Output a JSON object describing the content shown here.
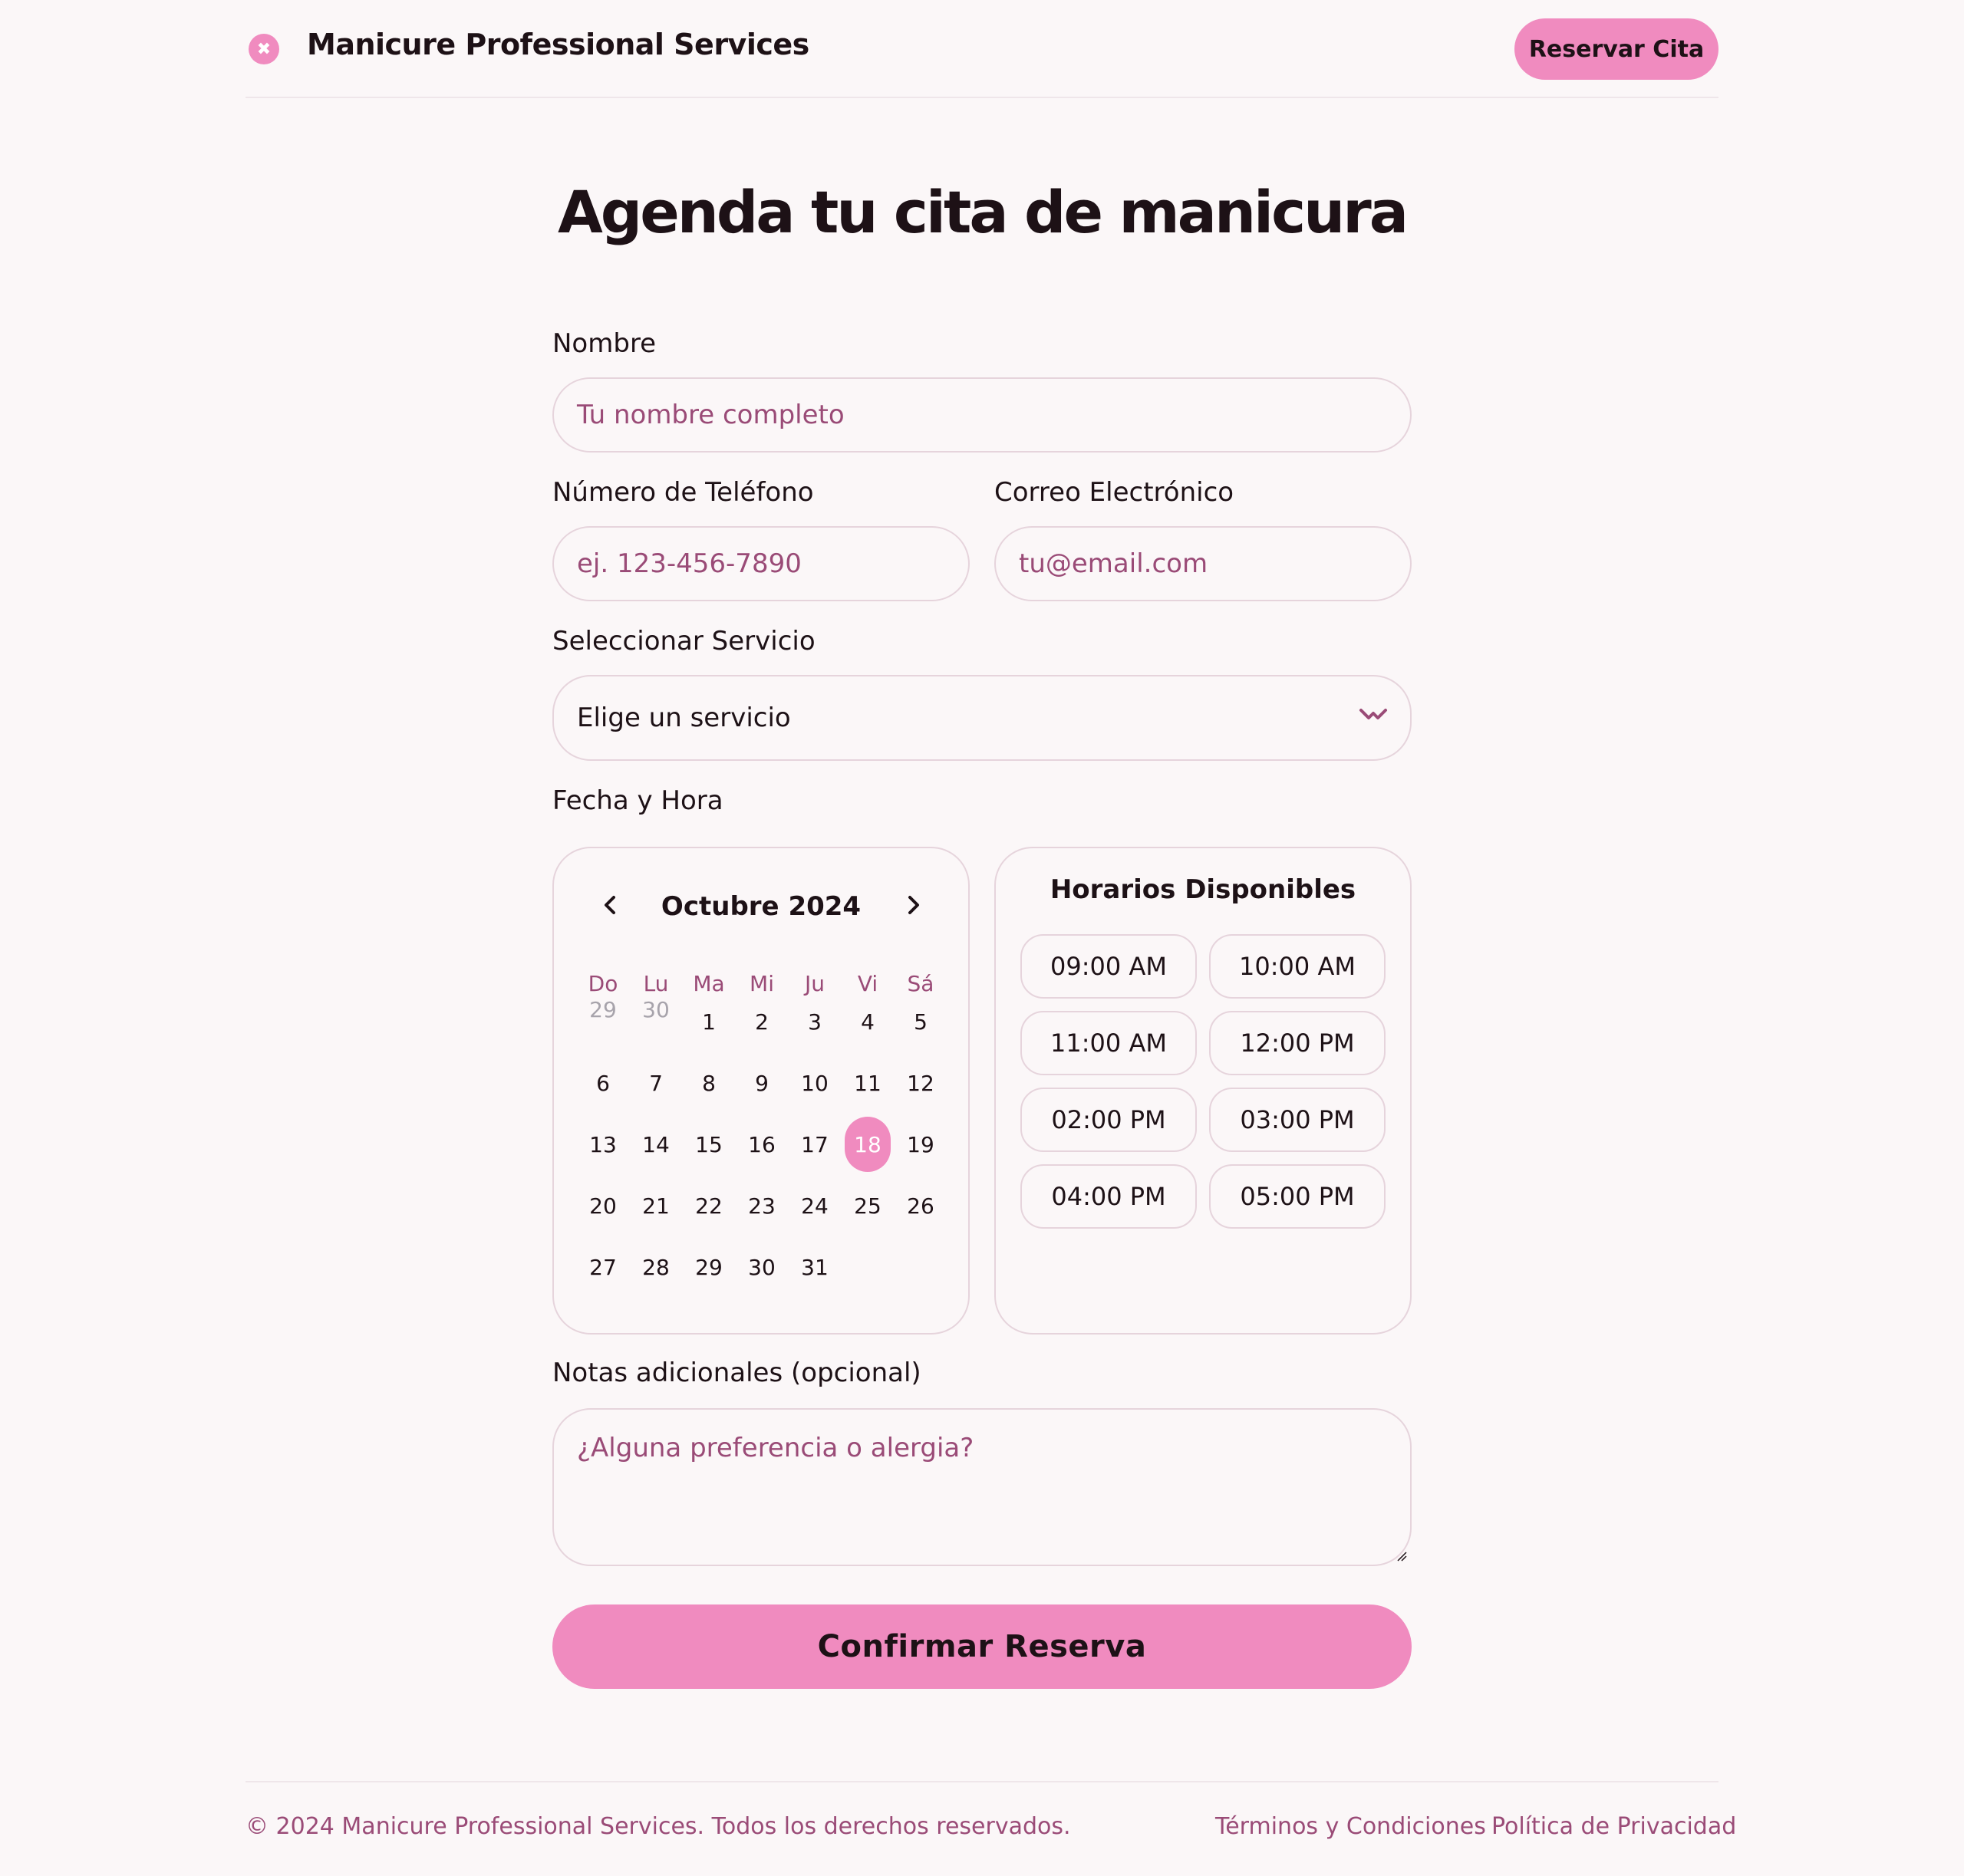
{
  "header": {
    "brand_icon": "close-icon",
    "brand_icon_glyph": "✖",
    "brand_name": "Manicure Professional Services",
    "cta_label": "Reservar Cita"
  },
  "page_title": "Agenda tu cita de manicura",
  "form": {
    "name_label": "Nombre",
    "name_placeholder": "Tu nombre completo",
    "phone_label": "Número de Teléfono",
    "phone_placeholder": "ej. 123-456-7890",
    "email_label": "Correo Electrónico",
    "email_placeholder": "tu@email.com",
    "service_label": "Seleccionar Servicio",
    "service_value": "Elige un servicio",
    "datetime_label": "Fecha y Hora",
    "notes_label": "Notas adicionales (opcional)",
    "notes_placeholder": "¿Alguna preferencia o alergia?",
    "submit_label": "Confirmar Reserva"
  },
  "calendar": {
    "month": "Octubre 2024",
    "weekdays": [
      "Do",
      "Lu",
      "Ma",
      "Mi",
      "Ju",
      "Vi",
      "Sá"
    ],
    "leading_days": [
      "29",
      "30"
    ],
    "selected_day": "18",
    "days": [
      "1",
      "2",
      "3",
      "4",
      "5",
      "6",
      "7",
      "8",
      "9",
      "10",
      "11",
      "12",
      "13",
      "14",
      "15",
      "16",
      "17",
      "18",
      "19",
      "20",
      "21",
      "22",
      "23",
      "24",
      "25",
      "26",
      "27",
      "28",
      "29",
      "30",
      "31"
    ]
  },
  "time_slots": {
    "title": "Horarios Disponibles",
    "slots": [
      "09:00 AM",
      "10:00 AM",
      "11:00 AM",
      "12:00 PM",
      "02:00 PM",
      "03:00 PM",
      "04:00 PM",
      "05:00 PM"
    ]
  },
  "footer": {
    "copyright": "© 2024 Manicure Professional Services. Todos los derechos reservados.",
    "terms": "Términos y Condiciones",
    "privacy": "Política de Privacidad"
  },
  "colors": {
    "accent": "#f08bbf",
    "background": "#fbf7f8",
    "muted_text": "#9a4b77",
    "border": "#e6d4dc"
  }
}
